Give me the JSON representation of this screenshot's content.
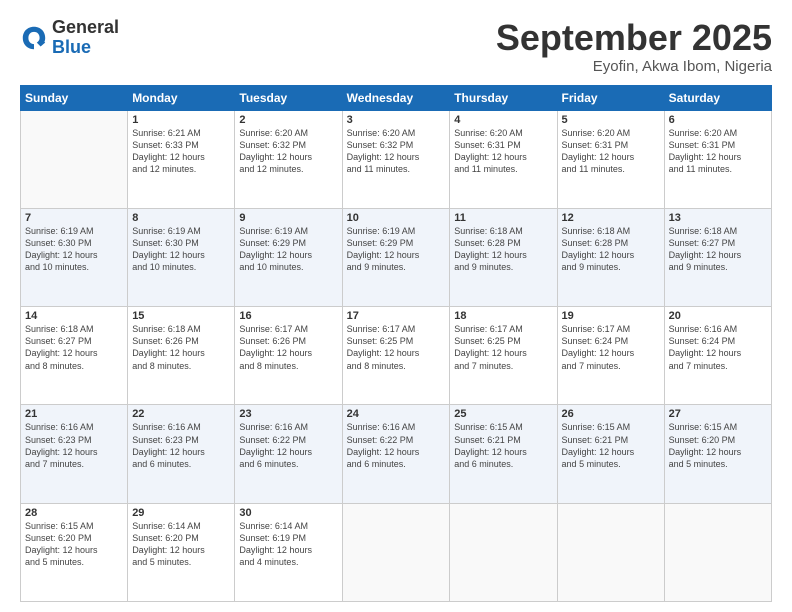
{
  "logo": {
    "general": "General",
    "blue": "Blue"
  },
  "title": "September 2025",
  "subtitle": "Eyofin, Akwa Ibom, Nigeria",
  "days_header": [
    "Sunday",
    "Monday",
    "Tuesday",
    "Wednesday",
    "Thursday",
    "Friday",
    "Saturday"
  ],
  "weeks": [
    [
      {
        "day": "",
        "info": ""
      },
      {
        "day": "1",
        "info": "Sunrise: 6:21 AM\nSunset: 6:33 PM\nDaylight: 12 hours\nand 12 minutes."
      },
      {
        "day": "2",
        "info": "Sunrise: 6:20 AM\nSunset: 6:32 PM\nDaylight: 12 hours\nand 12 minutes."
      },
      {
        "day": "3",
        "info": "Sunrise: 6:20 AM\nSunset: 6:32 PM\nDaylight: 12 hours\nand 11 minutes."
      },
      {
        "day": "4",
        "info": "Sunrise: 6:20 AM\nSunset: 6:31 PM\nDaylight: 12 hours\nand 11 minutes."
      },
      {
        "day": "5",
        "info": "Sunrise: 6:20 AM\nSunset: 6:31 PM\nDaylight: 12 hours\nand 11 minutes."
      },
      {
        "day": "6",
        "info": "Sunrise: 6:20 AM\nSunset: 6:31 PM\nDaylight: 12 hours\nand 11 minutes."
      }
    ],
    [
      {
        "day": "7",
        "info": "Sunrise: 6:19 AM\nSunset: 6:30 PM\nDaylight: 12 hours\nand 10 minutes."
      },
      {
        "day": "8",
        "info": "Sunrise: 6:19 AM\nSunset: 6:30 PM\nDaylight: 12 hours\nand 10 minutes."
      },
      {
        "day": "9",
        "info": "Sunrise: 6:19 AM\nSunset: 6:29 PM\nDaylight: 12 hours\nand 10 minutes."
      },
      {
        "day": "10",
        "info": "Sunrise: 6:19 AM\nSunset: 6:29 PM\nDaylight: 12 hours\nand 9 minutes."
      },
      {
        "day": "11",
        "info": "Sunrise: 6:18 AM\nSunset: 6:28 PM\nDaylight: 12 hours\nand 9 minutes."
      },
      {
        "day": "12",
        "info": "Sunrise: 6:18 AM\nSunset: 6:28 PM\nDaylight: 12 hours\nand 9 minutes."
      },
      {
        "day": "13",
        "info": "Sunrise: 6:18 AM\nSunset: 6:27 PM\nDaylight: 12 hours\nand 9 minutes."
      }
    ],
    [
      {
        "day": "14",
        "info": "Sunrise: 6:18 AM\nSunset: 6:27 PM\nDaylight: 12 hours\nand 8 minutes."
      },
      {
        "day": "15",
        "info": "Sunrise: 6:18 AM\nSunset: 6:26 PM\nDaylight: 12 hours\nand 8 minutes."
      },
      {
        "day": "16",
        "info": "Sunrise: 6:17 AM\nSunset: 6:26 PM\nDaylight: 12 hours\nand 8 minutes."
      },
      {
        "day": "17",
        "info": "Sunrise: 6:17 AM\nSunset: 6:25 PM\nDaylight: 12 hours\nand 8 minutes."
      },
      {
        "day": "18",
        "info": "Sunrise: 6:17 AM\nSunset: 6:25 PM\nDaylight: 12 hours\nand 7 minutes."
      },
      {
        "day": "19",
        "info": "Sunrise: 6:17 AM\nSunset: 6:24 PM\nDaylight: 12 hours\nand 7 minutes."
      },
      {
        "day": "20",
        "info": "Sunrise: 6:16 AM\nSunset: 6:24 PM\nDaylight: 12 hours\nand 7 minutes."
      }
    ],
    [
      {
        "day": "21",
        "info": "Sunrise: 6:16 AM\nSunset: 6:23 PM\nDaylight: 12 hours\nand 7 minutes."
      },
      {
        "day": "22",
        "info": "Sunrise: 6:16 AM\nSunset: 6:23 PM\nDaylight: 12 hours\nand 6 minutes."
      },
      {
        "day": "23",
        "info": "Sunrise: 6:16 AM\nSunset: 6:22 PM\nDaylight: 12 hours\nand 6 minutes."
      },
      {
        "day": "24",
        "info": "Sunrise: 6:16 AM\nSunset: 6:22 PM\nDaylight: 12 hours\nand 6 minutes."
      },
      {
        "day": "25",
        "info": "Sunrise: 6:15 AM\nSunset: 6:21 PM\nDaylight: 12 hours\nand 6 minutes."
      },
      {
        "day": "26",
        "info": "Sunrise: 6:15 AM\nSunset: 6:21 PM\nDaylight: 12 hours\nand 5 minutes."
      },
      {
        "day": "27",
        "info": "Sunrise: 6:15 AM\nSunset: 6:20 PM\nDaylight: 12 hours\nand 5 minutes."
      }
    ],
    [
      {
        "day": "28",
        "info": "Sunrise: 6:15 AM\nSunset: 6:20 PM\nDaylight: 12 hours\nand 5 minutes."
      },
      {
        "day": "29",
        "info": "Sunrise: 6:14 AM\nSunset: 6:20 PM\nDaylight: 12 hours\nand 5 minutes."
      },
      {
        "day": "30",
        "info": "Sunrise: 6:14 AM\nSunset: 6:19 PM\nDaylight: 12 hours\nand 4 minutes."
      },
      {
        "day": "",
        "info": ""
      },
      {
        "day": "",
        "info": ""
      },
      {
        "day": "",
        "info": ""
      },
      {
        "day": "",
        "info": ""
      }
    ]
  ]
}
